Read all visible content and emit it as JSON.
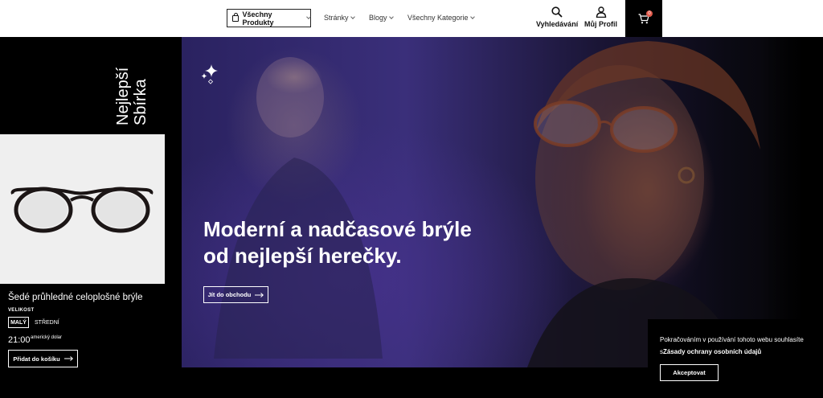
{
  "header": {
    "all_products_label": "Všechny Produkty",
    "nav": [
      {
        "label": "Stránky"
      },
      {
        "label": "Blogy"
      },
      {
        "label": "Všechny Kategorie"
      }
    ],
    "search_label": "Vyhledávání",
    "profile_label": "Můj Profil",
    "cart_count": "0"
  },
  "sidebar": {
    "title_line1": "Nejlepší",
    "title_line2": "Sbírka"
  },
  "product": {
    "name": "Šedé průhledné celoplošné brýle",
    "size_label": "VELIKOST",
    "sizes": [
      "MALÝ",
      "STŘEDNÍ"
    ],
    "price": "21:00",
    "currency": "americký dolar",
    "add_to_cart": "Přidat do košíku"
  },
  "hero": {
    "title_line1": "Moderní a nadčasové brýle",
    "title_line2": "od nejlepší herečky.",
    "cta": "Jít do obchodu"
  },
  "cookie": {
    "text_before": "Pokračováním v používání tohoto webu souhlasíte s",
    "link": "Zásady ochrany osobních údajů",
    "accept": "Akceptovat"
  },
  "colors": {
    "badge": "#e25a4b",
    "background": "#000000",
    "header": "#ffffff"
  }
}
